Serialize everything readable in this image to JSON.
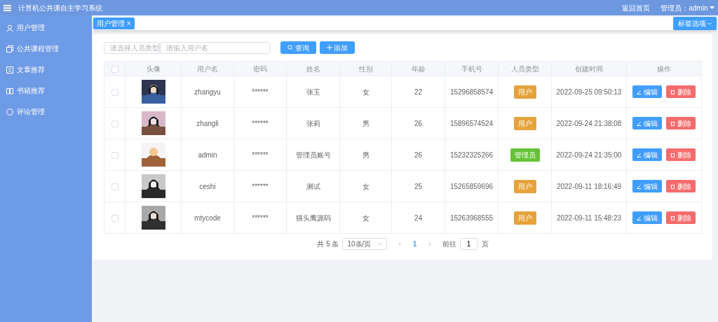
{
  "header": {
    "title": "计算机公共课自主学习系统",
    "home_link": "返回首页",
    "user_menu": "管理员：admin"
  },
  "sidebar": {
    "items": [
      {
        "label": "用户管理",
        "kind": "user",
        "selected": false
      },
      {
        "label": "公共课程管理",
        "kind": "copy",
        "selected": false
      },
      {
        "label": "文章推荐",
        "kind": "doc",
        "selected": false
      },
      {
        "label": "书籍推荐",
        "kind": "book",
        "selected": false
      },
      {
        "label": "评论管理",
        "kind": "chat",
        "selected": false
      }
    ]
  },
  "tabs": [
    {
      "label": "用户管理",
      "selected": true,
      "close": "×"
    }
  ],
  "tab_options_button": "标签选项",
  "filters": {
    "type_select": {
      "placeholder": "请选择人员类型"
    },
    "name_input": {
      "placeholder": "请输入用户名"
    },
    "search_button": "查询",
    "add_button": "添加"
  },
  "table": {
    "all_checked": false,
    "columns": [
      "头像",
      "用户名",
      "密码",
      "姓名",
      "性别",
      "年龄",
      "手机号",
      "人员类型",
      "创建时间",
      "操作"
    ],
    "rows": [
      {
        "checked": false,
        "username": "zhangyu",
        "password": "******",
        "name": "张玉",
        "gender": "女",
        "age": "22",
        "phone": "15296858574",
        "type": {
          "label": "用户",
          "color": "#e6a23c"
        },
        "created": "2022-09-25 09:50:13",
        "edit": "编辑",
        "delete": "删除"
      },
      {
        "checked": false,
        "username": "zhangli",
        "password": "******",
        "name": "张莉",
        "gender": "男",
        "age": "26",
        "phone": "15896574524",
        "type": {
          "label": "用户",
          "color": "#e6a23c"
        },
        "created": "2022-09-24 21:38:08",
        "edit": "编辑",
        "delete": "删除"
      },
      {
        "checked": false,
        "username": "admin",
        "password": "******",
        "name": "管理员账号",
        "gender": "男",
        "age": "26",
        "phone": "15232325266",
        "type": {
          "label": "管理员",
          "color": "#67c23a"
        },
        "created": "2022-09-24 21:35:00",
        "edit": "编辑",
        "delete": "删除"
      },
      {
        "checked": false,
        "username": "ceshi",
        "password": "******",
        "name": "测试",
        "gender": "女",
        "age": "25",
        "phone": "15265859696",
        "type": {
          "label": "用户",
          "color": "#e6a23c"
        },
        "created": "2022-09-11 18:16:49",
        "edit": "编辑",
        "delete": "删除"
      },
      {
        "checked": false,
        "username": "mtycode",
        "password": "******",
        "name": "猫头鹰源码",
        "gender": "女",
        "age": "24",
        "phone": "15263968555",
        "type": {
          "label": "用户",
          "color": "#e6a23c"
        },
        "created": "2022-09-11 15:48:23",
        "edit": "编辑",
        "delete": "删除"
      }
    ]
  },
  "pagination": {
    "total": "共 5 条",
    "page_size": "10条/页",
    "prev": "‹",
    "pages": [
      {
        "label": "1",
        "selected": true
      }
    ],
    "next": "›",
    "goto_label": "前往",
    "goto_value": "1",
    "goto_suffix": "页"
  }
}
